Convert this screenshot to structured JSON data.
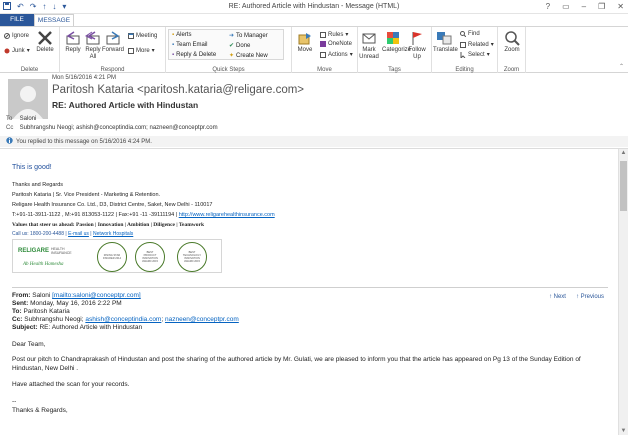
{
  "window": {
    "title": "RE: Authored Article with Hindustan - Message (HTML)",
    "controls": [
      "?",
      "▭",
      "–",
      "❐",
      "✕"
    ]
  },
  "tabs": {
    "file": "FILE",
    "message": "MESSAGE"
  },
  "ribbon": {
    "delete_group": {
      "label": "Delete",
      "ignore": "Ignore",
      "junk": "Junk",
      "delete": "Delete"
    },
    "respond_group": {
      "label": "Respond",
      "reply": "Reply",
      "reply_all": "Reply All",
      "forward": "Forward",
      "meeting": "Meeting",
      "more": "More"
    },
    "quick_steps": {
      "label": "Quick Steps",
      "items": [
        "Alerts",
        "Team Email",
        "Reply & Delete",
        "To Manager",
        "Done",
        "Create New"
      ]
    },
    "move_group": {
      "label": "Move",
      "move": "Move",
      "rules": "Rules",
      "onenote": "OneNote",
      "actions": "Actions"
    },
    "tags_group": {
      "label": "Tags",
      "mark_unread": "Mark Unread",
      "categorize": "Categorize",
      "follow_up": "Follow Up"
    },
    "editing_group": {
      "label": "Editing",
      "translate": "Translate",
      "find": "Find",
      "related": "Related",
      "select": "Select"
    },
    "zoom_group": {
      "label": "Zoom",
      "zoom": "Zoom"
    }
  },
  "header": {
    "date": "Mon 5/16/2016 4:21 PM",
    "from": "Paritosh Kataria <paritosh.kataria@religare.com>",
    "subject": "RE: Authored Article with Hindustan",
    "to_label": "To",
    "to": "Saloni",
    "cc_label": "Cc",
    "cc": "Subhrangshu Neogi; ashish@conceptindia.com; nazneen@conceptpr.com",
    "info": "You replied to this message on 5/16/2016 4:24 PM."
  },
  "body": {
    "greeting": "This is good!",
    "sig_thanks": "Thanks and Regards",
    "sig_name": "Paritosh Kataria | Sr. Vice President - Marketing & Retention.",
    "sig_company": "Religare Health Insurance Co. Ltd., D3, District Centre, Saket, New Delhi - 110017",
    "sig_phone": "T:+91-11-3911-1122 , M:+91 813053-1122 | Fax:+91 -11 -39111194 | ",
    "sig_web": "http://www.religarehealthinsurance.com",
    "sig_values": "Values that steer us ahead: Passion | Innovation | Ambition | Diligence | Teamwork",
    "sig_contact_prefix": "Call us: 1800-200-4488 | ",
    "sig_email_link": "E-mail us",
    "sig_network_link": "Network Hospitals",
    "banner": {
      "brand": "RELIGARE",
      "brand_sub": "HEALTH INSURANCE",
      "tagline": "Ab Health Hamesha",
      "awards": [
        "RISING STAR INSURER 2014",
        "BEST PRODUCT INNOVATION AWARD 2015",
        "BEST TECHNOLOGY INNOVATION AWARD 2015"
      ]
    },
    "quoted": {
      "from_label": "From:",
      "from_value": "Saloni ",
      "from_link": "[mailto:saloni@conceptpr.com]",
      "sent_label": "Sent:",
      "sent_value": "Monday, May 16, 2016 2:22 PM",
      "to_label": "To:",
      "to_value": "Paritosh Kataria",
      "cc_label": "Cc:",
      "cc_prefix": "Subhrangshu Neogi; ",
      "cc_link1": "ashish@conceptindia.com",
      "cc_sep": "; ",
      "cc_link2": "nazneen@conceptpr.com",
      "subject_label": "Subject:",
      "subject_value": "RE: Authored Article with Hindustan",
      "next": "Next",
      "previous": "Previous",
      "dear": "Dear Team,",
      "para1_line1": "Post our pitch to Chandraprakash of Hindustan and post the sharing of the authored article by Mr. Gulati, we are pleased to inform you that the article has appeared  on Pg 13 of the Sunday Edition of",
      "para1_line2": "Hindustan, New Delhi .",
      "para2": "Have attached the scan for your records.",
      "dash": "--",
      "thanks": "Thanks & Regards,"
    }
  }
}
